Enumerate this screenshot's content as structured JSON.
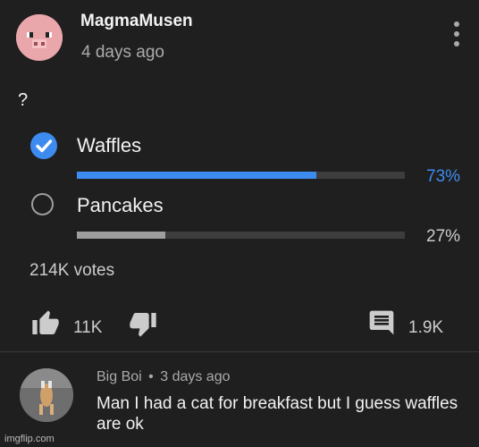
{
  "post": {
    "author": "MagmaMusen",
    "time": "4 days ago",
    "question": "?"
  },
  "poll": {
    "options": [
      {
        "label": "Waffles",
        "percent_text": "73%",
        "fraction": 0.73,
        "selected": true
      },
      {
        "label": "Pancakes",
        "percent_text": "27%",
        "fraction": 0.27,
        "selected": false
      }
    ],
    "votes": "214K votes"
  },
  "actions": {
    "likes": "11K",
    "comments": "1.9K"
  },
  "comment": {
    "author": "Big Boi",
    "separator": "•",
    "time": "3 days ago",
    "text": "Man I had a cat for breakfast but I guess waffles are ok"
  },
  "watermark": "imgflip.com",
  "colors": {
    "background": "#1f1f1f",
    "accent": "#3e8bf0",
    "bar_unselected": "#9e9e9e"
  },
  "icons": [
    "pig-avatar-icon",
    "more-vert-icon",
    "check-circle-icon",
    "radio-empty-icon",
    "thumb-up-icon",
    "thumb-down-icon",
    "comment-icon"
  ]
}
